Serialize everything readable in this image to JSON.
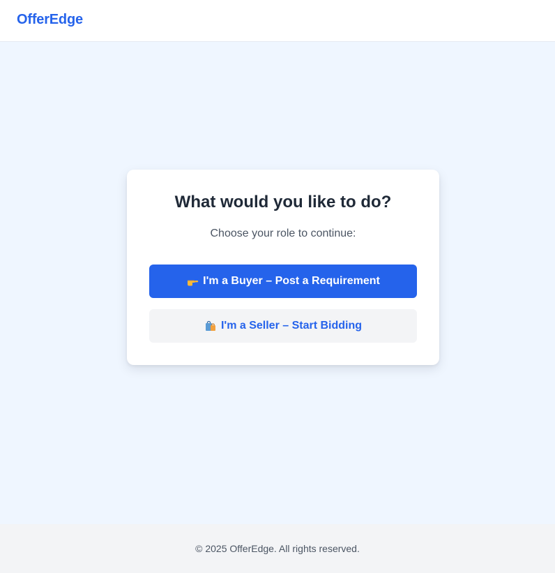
{
  "header": {
    "brand": "OfferEdge"
  },
  "card": {
    "title": "What would you like to do?",
    "subtitle": "Choose your role to continue:",
    "buyer_button": {
      "icon": "pointing-hand-icon",
      "label": "I'm a Buyer – Post a Requirement"
    },
    "seller_button": {
      "icon": "shopping-bags-icon",
      "label": "I'm a Seller – Start Bidding"
    }
  },
  "footer": {
    "copyright": "© 2025 OfferEdge. All rights reserved."
  },
  "colors": {
    "accent": "#2563eb",
    "page_bg": "#eff6ff",
    "secondary_button_bg": "#f3f4f6",
    "footer_bg": "#f3f4f6"
  }
}
